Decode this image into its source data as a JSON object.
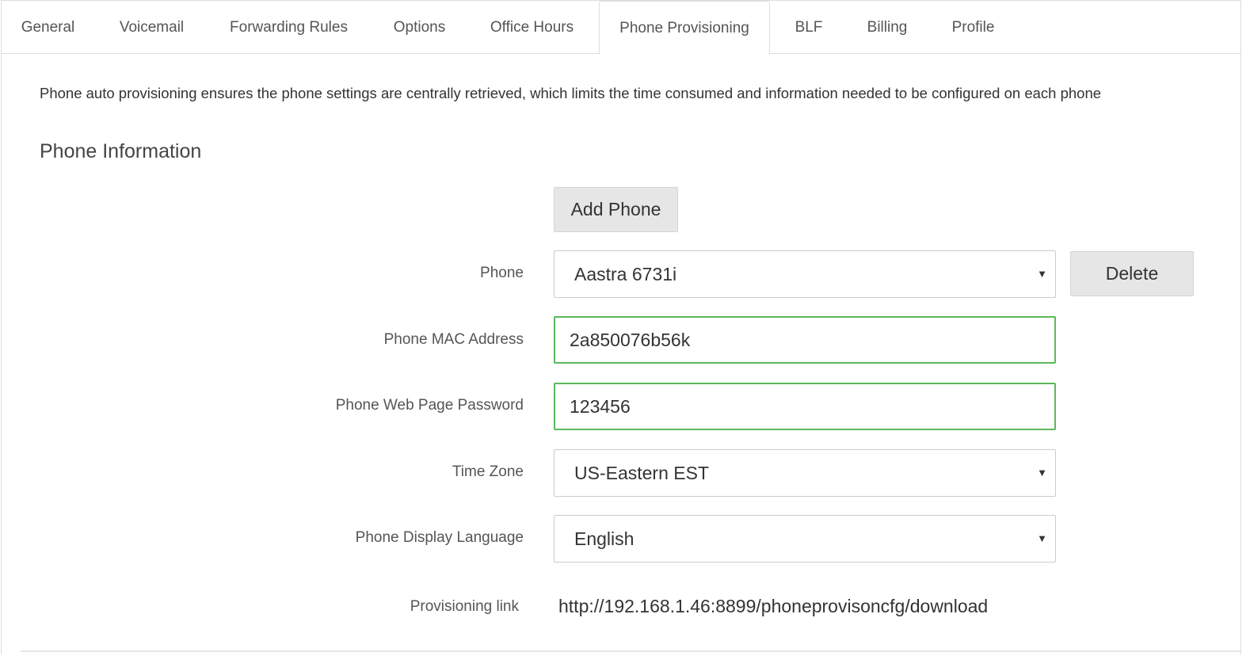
{
  "tabs": [
    {
      "label": "General",
      "active": false
    },
    {
      "label": "Voicemail",
      "active": false
    },
    {
      "label": "Forwarding Rules",
      "active": false
    },
    {
      "label": "Options",
      "active": false
    },
    {
      "label": "Office Hours",
      "active": false
    },
    {
      "label": "Phone Provisioning",
      "active": true
    },
    {
      "label": "BLF",
      "active": false
    },
    {
      "label": "Billing",
      "active": false
    },
    {
      "label": "Profile",
      "active": false
    }
  ],
  "description": "Phone auto provisioning ensures the phone settings are centrally retrieved, which limits the time consumed and information needed to be configured on each phone",
  "section_title": "Phone Information",
  "buttons": {
    "add_phone": "Add Phone",
    "delete": "Delete"
  },
  "form": {
    "phone": {
      "label": "Phone",
      "value": "Aastra 6731i"
    },
    "mac": {
      "label": "Phone MAC Address",
      "value": "2a850076b56k"
    },
    "password": {
      "label": "Phone Web Page Password",
      "value": "123456"
    },
    "timezone": {
      "label": "Time Zone",
      "value": "US-Eastern EST"
    },
    "language": {
      "label": "Phone Display Language",
      "value": "English"
    },
    "provisioning_link": {
      "label": "Provisioning link",
      "value": "http://192.168.1.46:8899/phoneprovisoncfg/download"
    }
  },
  "colors": {
    "valid_border": "#5cb85c",
    "button_bg": "#e6e6e6"
  }
}
